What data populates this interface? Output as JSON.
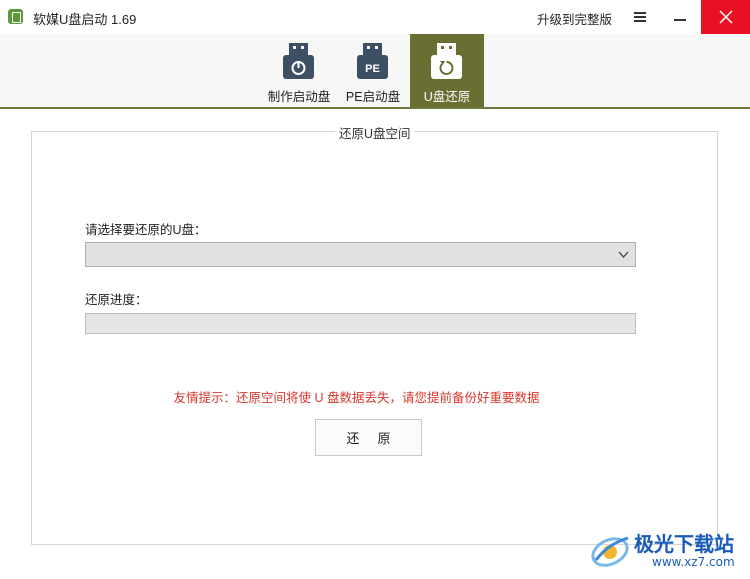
{
  "app": {
    "title": "软媒U盘启动 1.69",
    "upgrade_label": "升级到完整版"
  },
  "tabs": [
    {
      "label": "制作启动盘",
      "icon": "usb-power-icon",
      "active": false
    },
    {
      "label": "PE启动盘",
      "icon": "usb-pe-icon",
      "active": false
    },
    {
      "label": "U盘还原",
      "icon": "usb-restore-icon",
      "active": true
    }
  ],
  "restore": {
    "group_title": "还原U盘空间",
    "select_label": "请选择要还原的U盘：",
    "selected_drive": "",
    "progress_label": "还原进度：",
    "progress_value": 0,
    "tip": "友情提示：还原空间将使 U 盘数据丢失，请您提前备份好重要数据",
    "button_label": "还原"
  },
  "watermark": {
    "name": "极光下载站",
    "url": "www.xz7.com"
  },
  "colors": {
    "accent": "#6b6e33",
    "close": "#e81123",
    "tip": "#d9372d",
    "icon": "#3d4f63"
  }
}
